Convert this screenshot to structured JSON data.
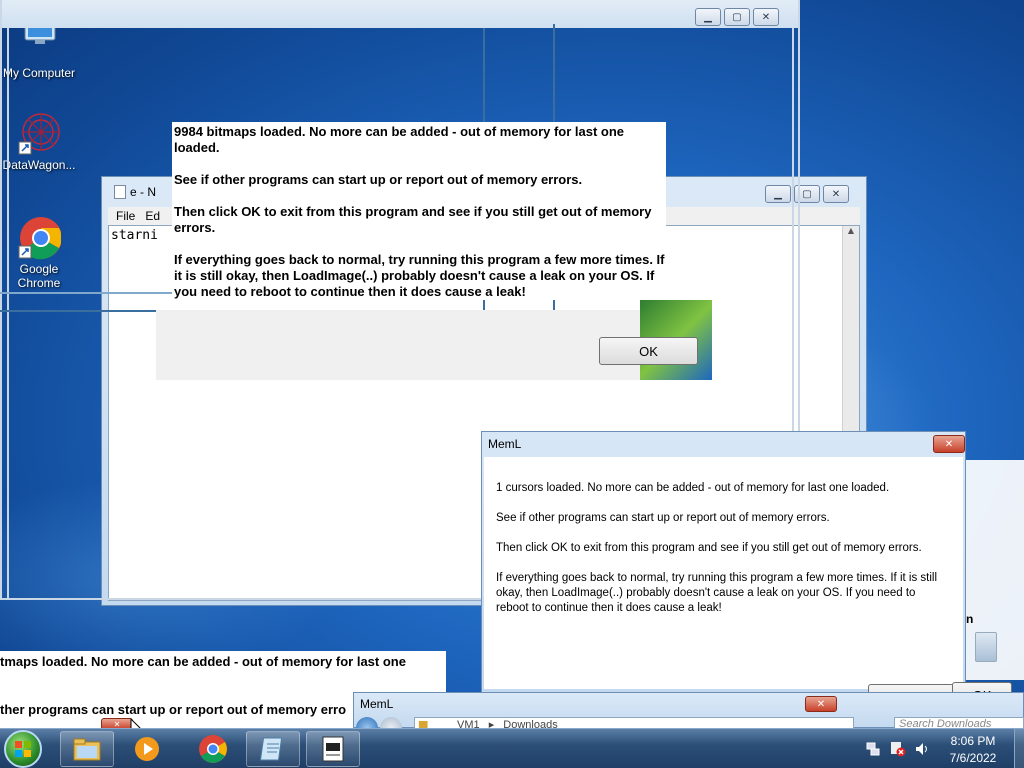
{
  "desktop_icons": [
    {
      "label": "My Computer"
    },
    {
      "label": "DataWagon..."
    },
    {
      "label": "Google Chrome"
    }
  ],
  "notepad": {
    "title": "e - N",
    "menu": [
      "File",
      "Ed"
    ],
    "text": "starni"
  },
  "big_dialog": {
    "message": "9984 bitmaps loaded. No more can be added - out of memory for last one loaded.\n\nSee if other programs can start up or report out of memory errors.\n\nThen click OK to exit from this program and see if you still get out of memory errors.\n\nIf everything goes back to normal, try running this program a few more times. If it is still okay, then LoadImage(..) probably doesn't cause a leak on your OS. If you need to reboot to continue then it does cause a leak!",
    "ok_label": "OK"
  },
  "meml_dialog": {
    "title": "MemL",
    "p1": "1 cursors loaded. No more can be added - out of memory for last one loaded.",
    "p2": "See if other programs can start up or report out of memory errors.",
    "p3": "Then click OK to exit from this program and see if you still get out of memory errors.",
    "p4": "If everything goes back to normal, try running this program a few more times. If it is still okay, then LoadImage(..) probably doesn't cause a leak on your OS. If you need to reboot to continue then it does cause a leak!",
    "ok_label": "OK",
    "ok_label_right": "OK"
  },
  "bottom_fragment": {
    "line1": "tmaps loaded. No more can be added - out of memory for last one",
    "line2": "ther programs can start up or report out of memory erro"
  },
  "explorer": {
    "title": "MemL",
    "path_root": "VM1",
    "path_child": "Downloads",
    "search_placeholder": "Search Downloads"
  },
  "side_fragment": "n",
  "tray": {
    "time": "8:06 PM",
    "date": "7/6/2022"
  },
  "colors": {
    "accent": "#1e66bf",
    "taskbar": "#2c4f78",
    "close_red": "#c7412a"
  }
}
